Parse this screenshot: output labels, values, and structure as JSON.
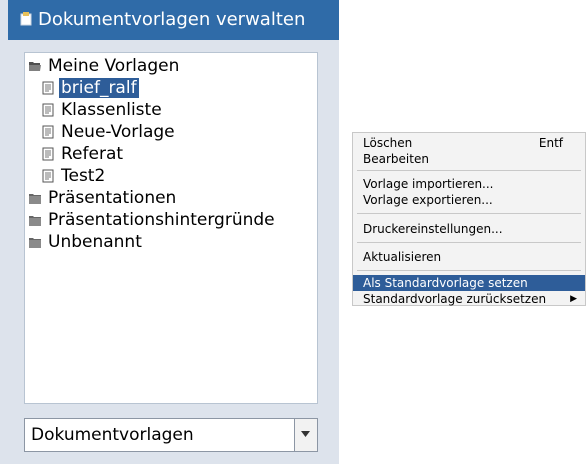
{
  "window": {
    "title": "Dokumentvorlagen verwalten"
  },
  "tree": {
    "items": [
      {
        "label": "Meine Vorlagen",
        "icon": "folder-open-icon"
      },
      {
        "label": "brief_ralf",
        "icon": "document-icon",
        "selected": true
      },
      {
        "label": "Klassenliste",
        "icon": "document-icon"
      },
      {
        "label": "Neue-Vorlage",
        "icon": "document-icon"
      },
      {
        "label": "Referat",
        "icon": "document-icon"
      },
      {
        "label": "Test2",
        "icon": "document-icon"
      },
      {
        "label": "Präsentationen",
        "icon": "folder-icon"
      },
      {
        "label": "Präsentationshintergründe",
        "icon": "folder-icon"
      },
      {
        "label": "Unbenannt",
        "icon": "folder-icon"
      }
    ]
  },
  "combo": {
    "value": "Dokumentvorlagen"
  },
  "menu": {
    "items": [
      {
        "label": "Löschen",
        "accelerator": "Entf"
      },
      {
        "label": "Bearbeiten"
      },
      {
        "label": "Vorlage importieren..."
      },
      {
        "label": "Vorlage exportieren..."
      },
      {
        "label": "Druckereinstellungen..."
      },
      {
        "label": "Aktualisieren"
      },
      {
        "label": "Als Standardvorlage setzen",
        "highlighted": true
      },
      {
        "label": "Standardvorlage zurücksetzen",
        "submenu": true
      }
    ]
  },
  "colors": {
    "titlebar": "#2f6ba8",
    "selection": "#2e5d99",
    "panel": "#dde3ec"
  }
}
